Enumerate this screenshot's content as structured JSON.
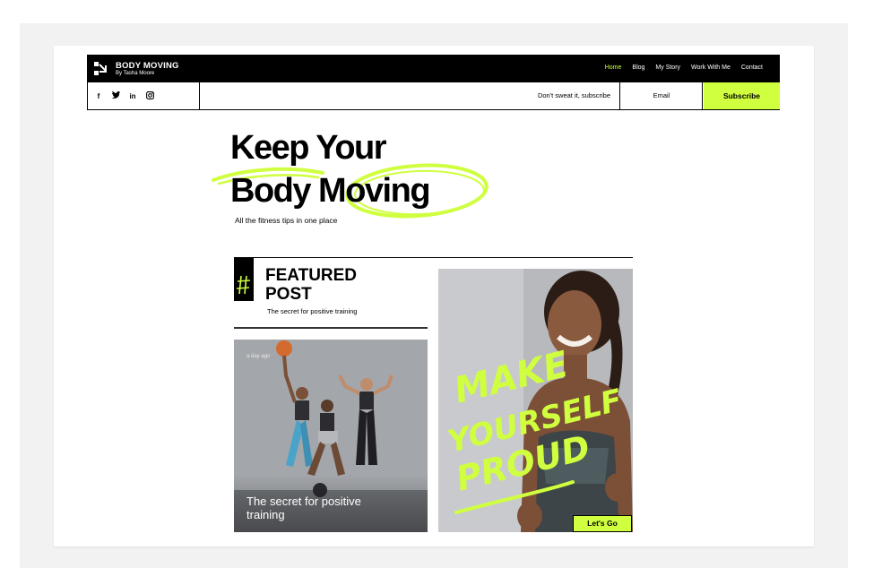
{
  "brand": {
    "title": "BODY MOVING",
    "subtitle": "By Tasha Moore"
  },
  "nav": [
    {
      "label": "Home",
      "active": true
    },
    {
      "label": "Blog"
    },
    {
      "label": "My Story"
    },
    {
      "label": "Work With Me"
    },
    {
      "label": "Contact"
    }
  ],
  "social": [
    {
      "icon": "facebook-icon",
      "glyph": "f"
    },
    {
      "icon": "twitter-icon",
      "glyph": "t"
    },
    {
      "icon": "linkedin-icon",
      "glyph": "in"
    },
    {
      "icon": "instagram-icon",
      "glyph": "◎"
    }
  ],
  "subscribe": {
    "tagline": "Don't sweat it, subscribe",
    "email_placeholder": "Email",
    "button": "Subscribe"
  },
  "hero": {
    "line1": "Keep Your",
    "line2": "Body Moving",
    "subtitle": "All the fitness tips in one place"
  },
  "featured": {
    "title": "FEATURED POST",
    "subtitle": "The secret for positive training",
    "post": {
      "date": "a day ago",
      "title": "The secret for positive training"
    }
  },
  "promo": {
    "text_lines": [
      "MAKE",
      "YOURSELF",
      "PROUD"
    ],
    "button": "Let's Go"
  },
  "colors": {
    "accent": "#cfff3f",
    "black": "#000000"
  }
}
